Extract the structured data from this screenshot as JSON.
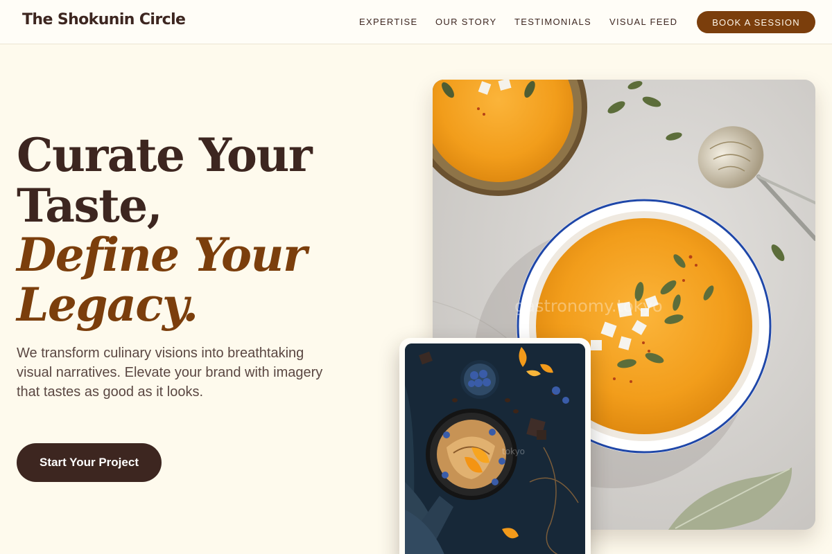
{
  "brand": "The Shokunin Circle",
  "nav": {
    "links": [
      "EXPERTISE",
      "OUR STORY",
      "TESTIMONIALS",
      "VISUAL FEED"
    ],
    "cta_label": "BOOK A SESSION"
  },
  "hero": {
    "title_line1": "Curate Your",
    "title_line2": "Taste,",
    "title_line3": "Define Your",
    "title_line4": "Legacy.",
    "description": "We transform culinary visions into breathtaking visual narratives. Elevate your brand with imagery that tastes as good as it looks.",
    "cta_label": "Start Your Project"
  },
  "images": {
    "main_watermark": "gastronomy.tokyo",
    "secondary_watermark": "tokyo"
  },
  "colors": {
    "background": "#fefaed",
    "brand_dark": "#3d2620",
    "accent_brown": "#7b3e0c",
    "soup_orange": "#f5a623"
  }
}
